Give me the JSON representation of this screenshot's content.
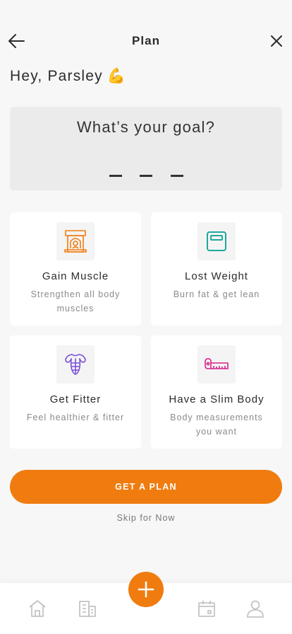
{
  "header": {
    "title": "Plan",
    "back_icon": "arrow-left-icon",
    "close_icon": "close-icon"
  },
  "greeting": {
    "text": "Hey, Parsley",
    "emoji": "💪"
  },
  "goal": {
    "question": "What’s your goal?",
    "selected_placeholder": "— — —"
  },
  "cards": [
    {
      "title": "Gain Muscle",
      "desc": "Strengthen all body muscles",
      "icon": "muscle-building-icon",
      "color": "#f07c10"
    },
    {
      "title": "Lost Weight",
      "desc": "Burn fat & get lean",
      "icon": "scale-icon",
      "color": "#1fa89a"
    },
    {
      "title": "Get Fitter",
      "desc": "Feel healthier & fitter",
      "icon": "body-torso-icon",
      "color": "#7b4fd6"
    },
    {
      "title": "Have a Slim Body",
      "desc": "Body measurements you want",
      "icon": "measuring-tape-icon",
      "color": "#d6208a"
    }
  ],
  "cta": {
    "label": "GET A PLAN"
  },
  "skip": {
    "label": "Skip for Now"
  },
  "tabbar": {
    "items": [
      "home-icon",
      "building-icon",
      "add-icon",
      "calendar-icon",
      "profile-icon"
    ]
  },
  "colors": {
    "accent": "#f07c10",
    "background": "#f7f7f7",
    "text": "#2b2b2b",
    "muted": "#8a8a8a",
    "icon_gray": "#c4c4c4"
  }
}
